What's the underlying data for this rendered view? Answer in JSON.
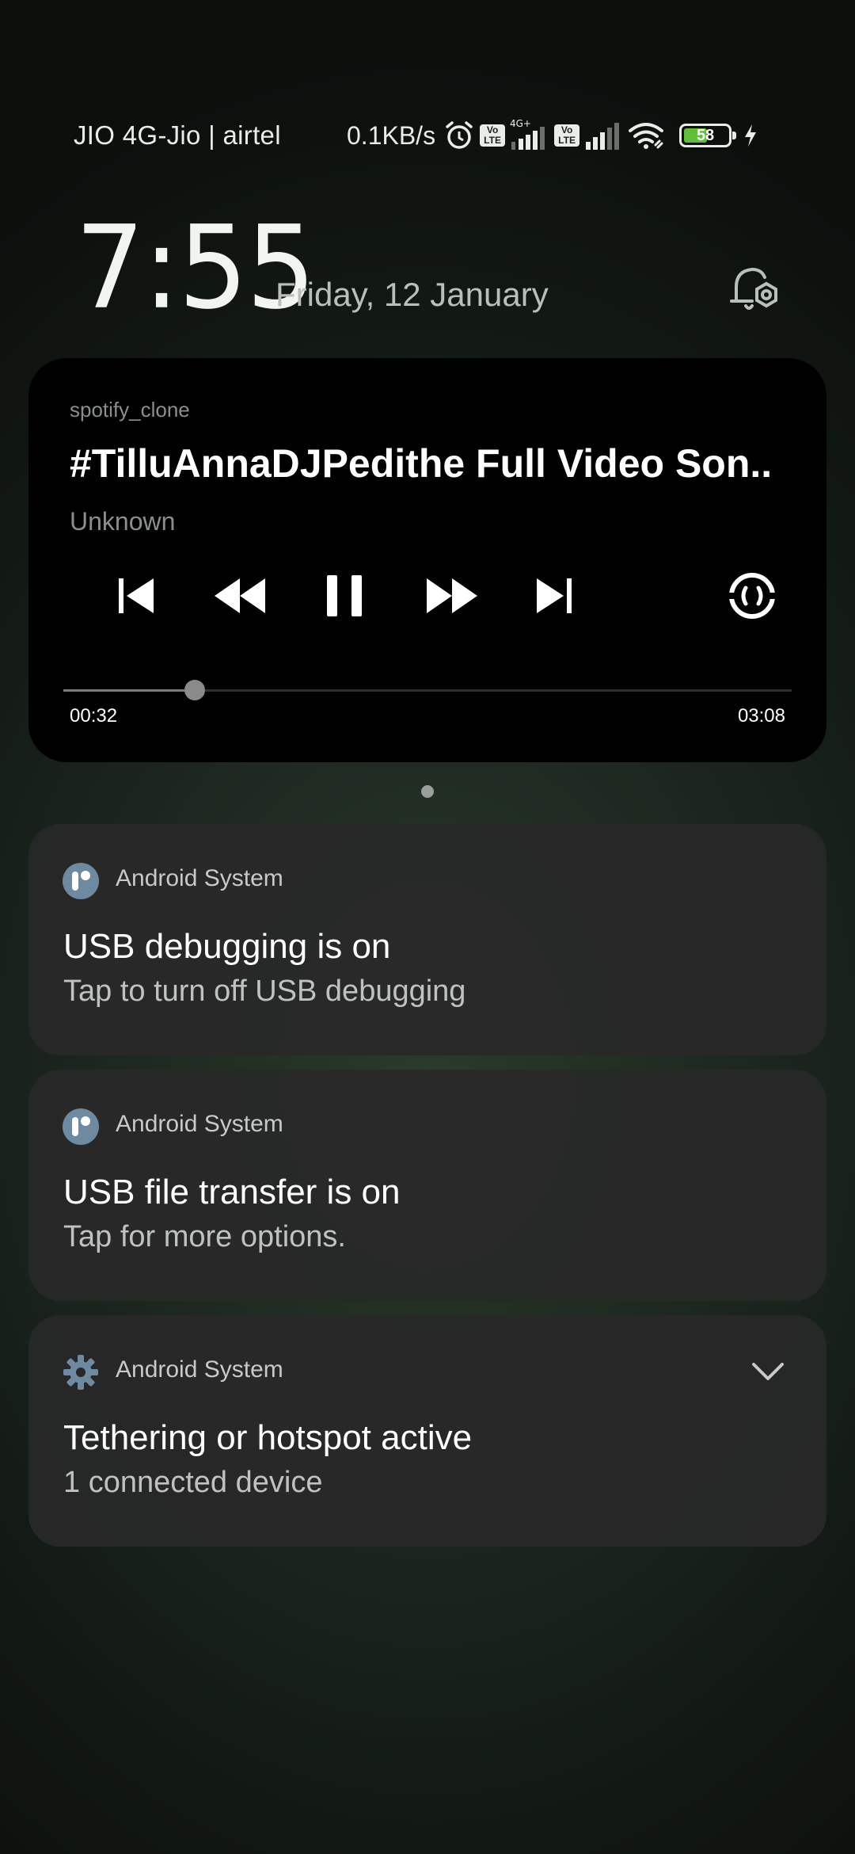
{
  "status_bar": {
    "carrier": "JIO 4G-Jio | airtel",
    "net_speed": "0.1KB/s",
    "icons": [
      "alarm-icon",
      "volte-icon",
      "signal-4g-plus-icon",
      "volte-icon",
      "signal-icon",
      "wifi-hotspot-icon",
      "battery-icon",
      "charging-icon"
    ],
    "network_type": "4G+",
    "volte_label": "Vo\nLTE",
    "battery_percent": "58",
    "battery_level": 0.58,
    "battery_color": "#5fbf3a"
  },
  "lockscreen": {
    "time": "7:55",
    "date": "Friday, 12 January"
  },
  "media": {
    "app_name": "spotify_clone",
    "title": "#TilluAnnaDJPedithe Full Video Son..",
    "artist": "Unknown",
    "elapsed": "00:32",
    "duration": "03:08",
    "progress": 0.18,
    "controls": [
      "skip-previous-icon",
      "rewind-icon",
      "pause-icon",
      "fast-forward-icon",
      "skip-next-icon",
      "cast-output-icon"
    ]
  },
  "notifications": [
    {
      "app": "Android System",
      "icon": "usb-debug-icon",
      "title": "USB debugging is on",
      "text": "Tap to turn off USB debugging"
    },
    {
      "app": "Android System",
      "icon": "usb-debug-icon",
      "title": "USB file transfer is on",
      "text": "Tap for more options."
    },
    {
      "app": "Android System",
      "icon": "gear-icon",
      "title": "Tethering or hotspot active",
      "text": "1 connected device"
    }
  ],
  "colors": {
    "accent_icon": "#6d8aa0",
    "card_bg": "#282828",
    "media_bg": "#000000"
  }
}
